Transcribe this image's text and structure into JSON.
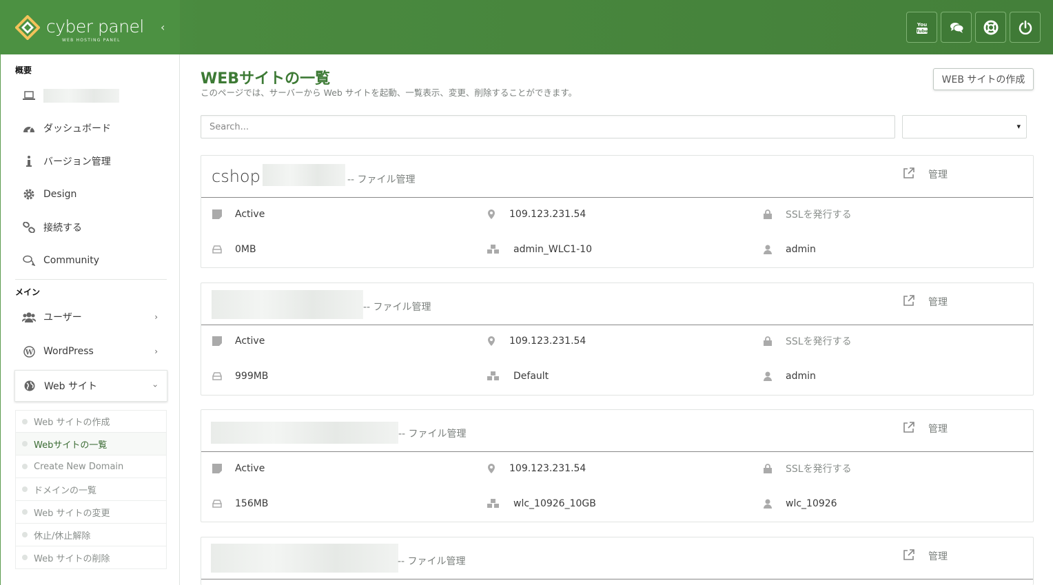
{
  "header": {
    "logo_text": "cyber panel",
    "logo_sub": "WEB HOSTING PANEL",
    "buttons": [
      "youtube-icon",
      "chat-icon",
      "support-icon",
      "power-icon"
    ]
  },
  "sidebar": {
    "section_overview": "概要",
    "section_main": "メイン",
    "items": [
      {
        "label": "ダッシュボード",
        "icon": "dashboard-icon"
      },
      {
        "label": "バージョン管理",
        "icon": "info-icon"
      },
      {
        "label": "Design",
        "icon": "gear-icon"
      },
      {
        "label": "接続する",
        "icon": "link-icon"
      },
      {
        "label": "Community",
        "icon": "comments-icon"
      },
      {
        "label": "ユーザー",
        "icon": "users-icon"
      },
      {
        "label": "WordPress",
        "icon": "wordpress-icon"
      },
      {
        "label": "Web サイト",
        "icon": "globe-icon"
      }
    ],
    "sub_items": [
      "Web サイトの作成",
      "Webサイトの一覧",
      "Create New Domain",
      "ドメインの一覧",
      "Web サイトの変更",
      "休止/休止解除",
      "Web サイトの削除"
    ]
  },
  "main": {
    "title": "WEBサイトの一覧",
    "description": "このページでは、サーバーから Web サイトを起動、一覧表示、変更、削除することができます。",
    "create_button": "WEB サイトの作成",
    "search_placeholder": "Search...",
    "file_manager_label": "-- ファイル管理",
    "manage_label": "管理",
    "sites": [
      {
        "name": "cshop",
        "status": "Active",
        "ip": "109.123.231.54",
        "ssl": "SSLを発行する",
        "disk": "0MB",
        "package": "admin_WLC1-10",
        "owner": "admin"
      },
      {
        "name": "",
        "status": "Active",
        "ip": "109.123.231.54",
        "ssl": "SSLを発行する",
        "disk": "999MB",
        "package": "Default",
        "owner": "admin"
      },
      {
        "name": "",
        "status": "Active",
        "ip": "109.123.231.54",
        "ssl": "SSLを発行する",
        "disk": "156MB",
        "package": "wlc_10926_10GB",
        "owner": "wlc_10926"
      },
      {
        "name": ""
      }
    ]
  }
}
